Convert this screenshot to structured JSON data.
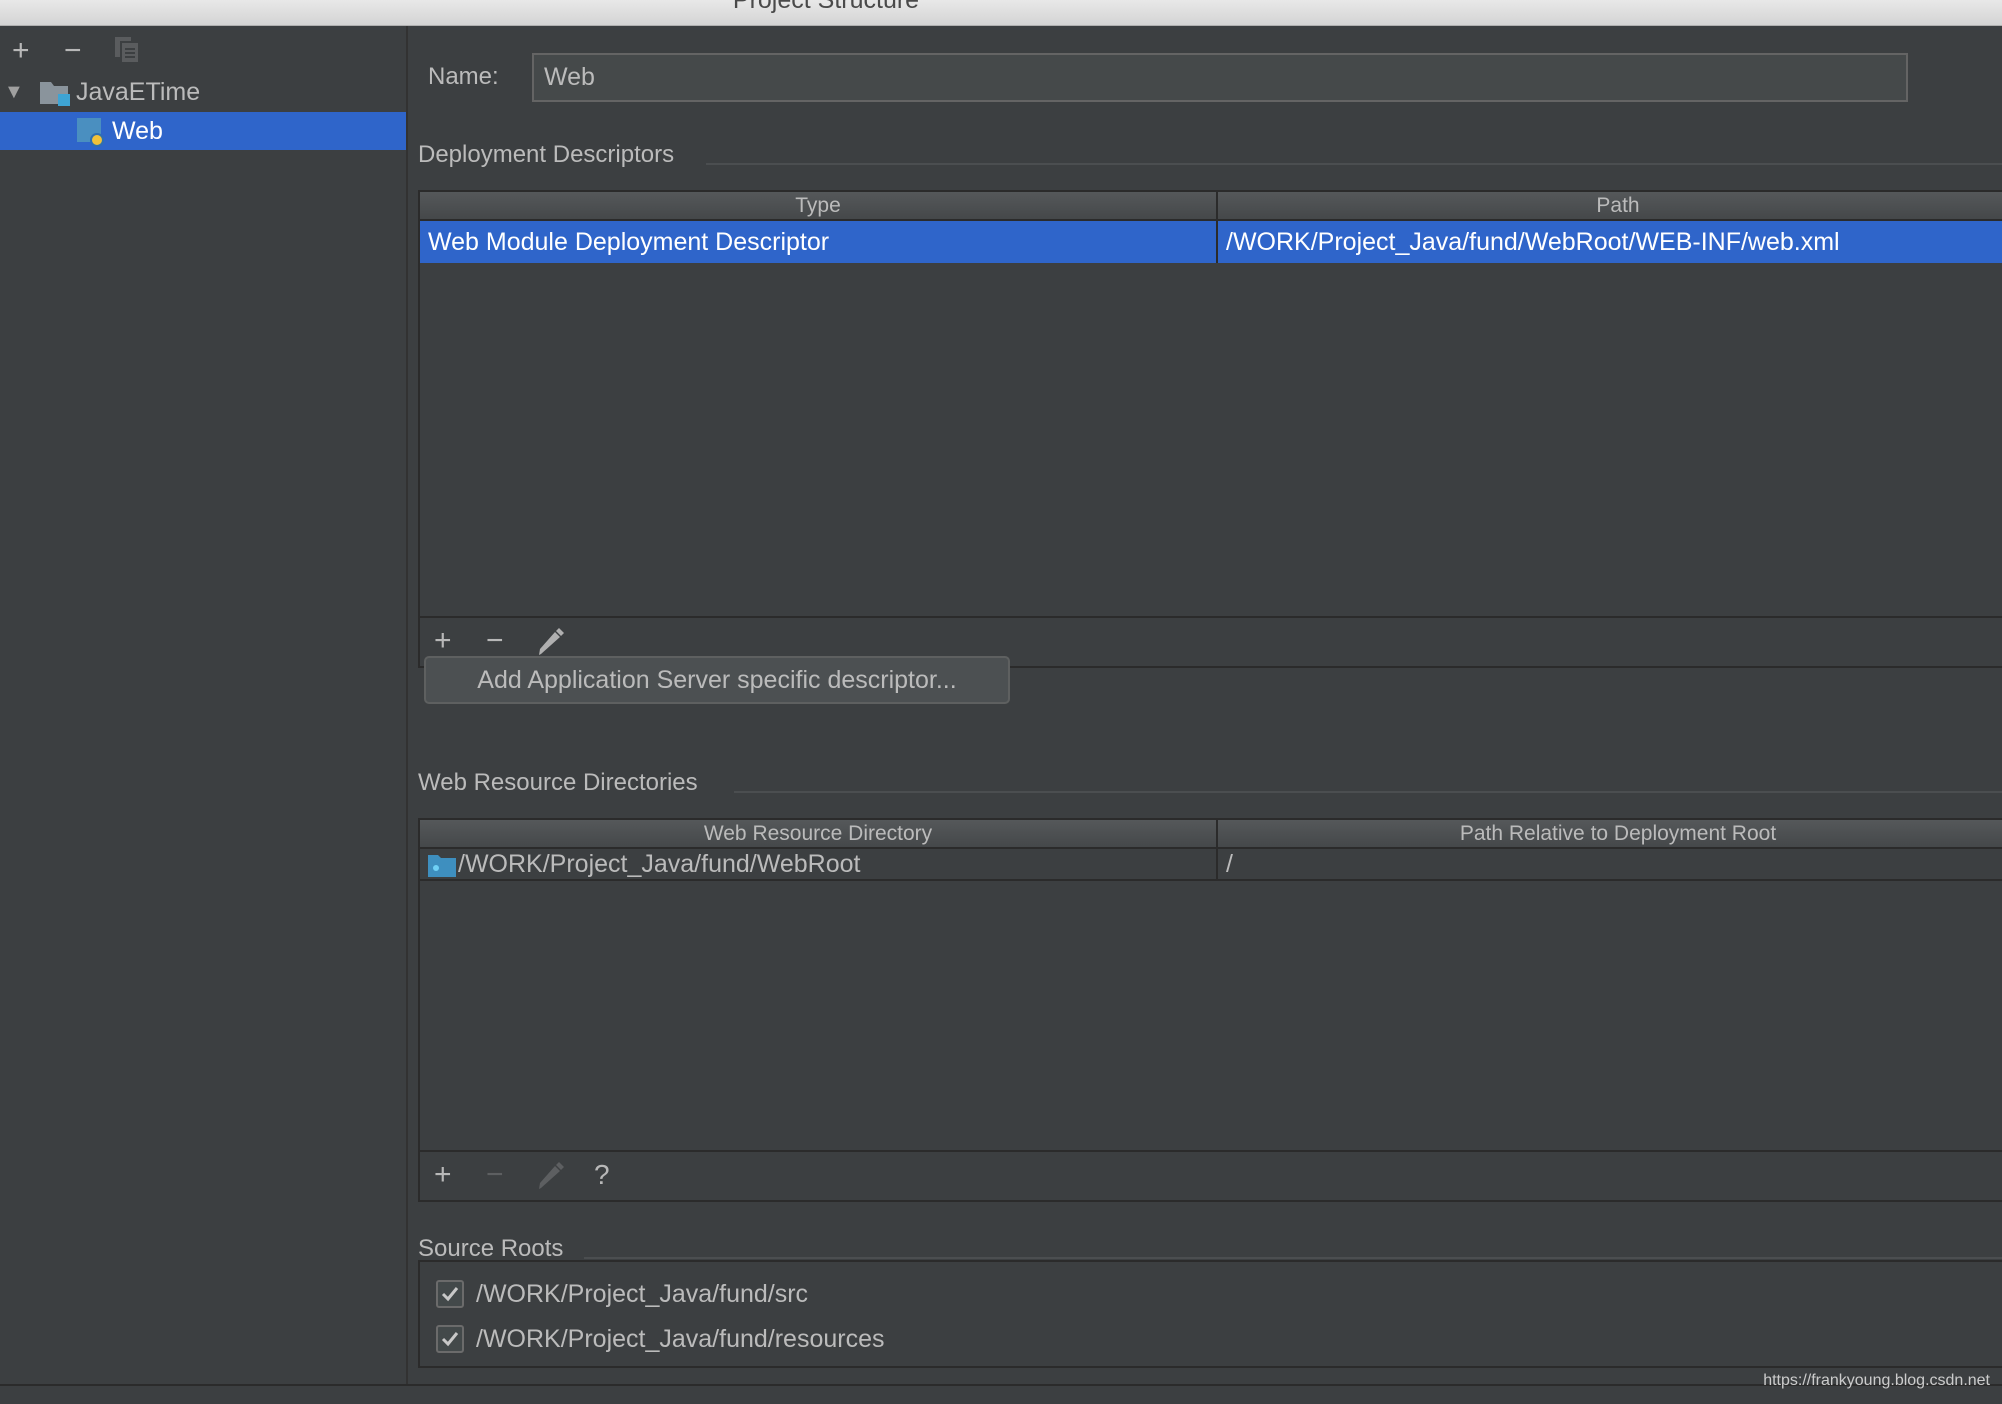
{
  "window": {
    "title": "Project Structure"
  },
  "sidebar": {
    "toolbar": {
      "add": "+",
      "remove": "−",
      "copy_icon": "copy-icon"
    },
    "tree": [
      {
        "label": "JavaETime",
        "icon": "module-folder-icon",
        "expanded": true,
        "selected": false
      },
      {
        "label": "Web",
        "icon": "web-facet-icon",
        "selected": true
      }
    ]
  },
  "main": {
    "name_label": "Name:",
    "name_value": "Web",
    "deployment_descriptors": {
      "title": "Deployment Descriptors",
      "columns": [
        "Type",
        "Path"
      ],
      "rows": [
        {
          "type": "Web Module Deployment Descriptor",
          "path": "/WORK/Project_Java/fund/WebRoot/WEB-INF/web.xml",
          "selected": true
        }
      ],
      "toolbar": {
        "add": "+",
        "remove": "−",
        "edit": "edit-icon"
      },
      "add_server_button": "Add Application Server specific descriptor..."
    },
    "web_resource_directories": {
      "title": "Web Resource Directories",
      "columns": [
        "Web Resource Directory",
        "Path Relative to Deployment Root"
      ],
      "rows": [
        {
          "directory": "/WORK/Project_Java/fund/WebRoot",
          "relative_path": "/"
        }
      ],
      "toolbar": {
        "add": "+",
        "remove": "−",
        "edit": "edit-icon",
        "help": "?"
      }
    },
    "source_roots": {
      "title": "Source Roots",
      "items": [
        {
          "path": "/WORK/Project_Java/fund/src",
          "checked": true
        },
        {
          "path": "/WORK/Project_Java/fund/resources",
          "checked": true
        }
      ]
    }
  },
  "watermark": "https://frankyoung.blog.csdn.net",
  "colors": {
    "selection": "#2f65ca",
    "background": "#3c3f41",
    "text": "#bbbbbb"
  }
}
